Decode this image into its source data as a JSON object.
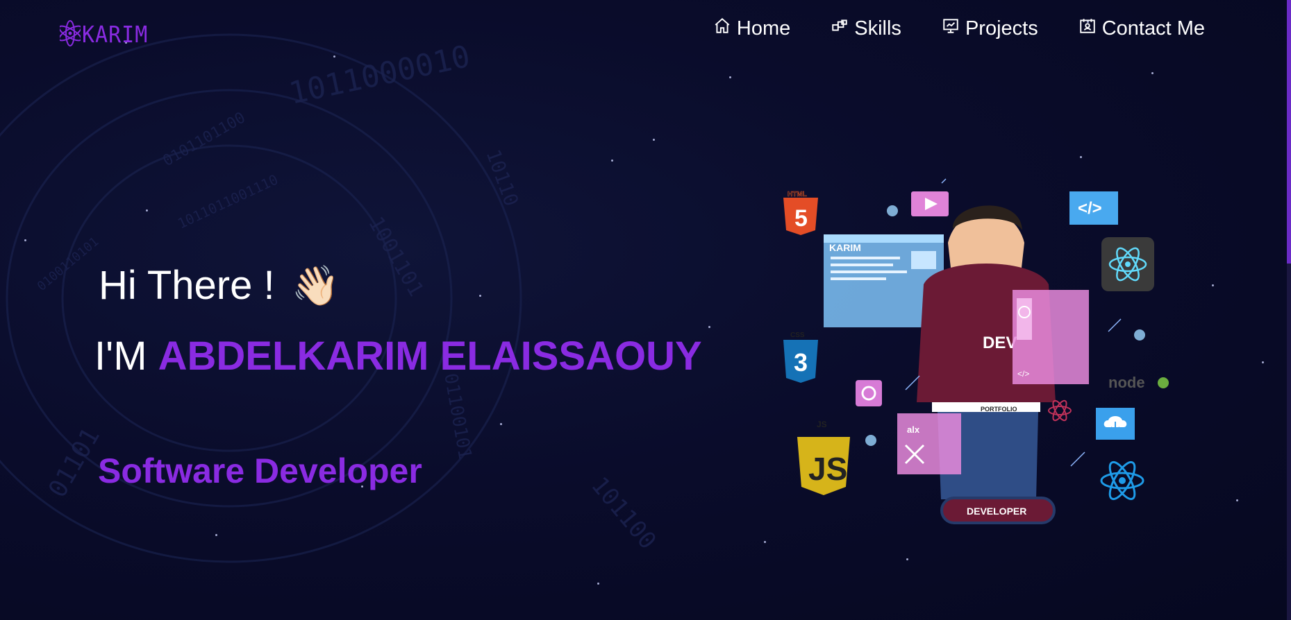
{
  "logo": {
    "text": "KARIM",
    "icon": "atom-icon"
  },
  "nav": [
    {
      "label": "Home",
      "icon": "home-icon"
    },
    {
      "label": "Skills",
      "icon": "skills-icon"
    },
    {
      "label": "Projects",
      "icon": "projects-icon"
    },
    {
      "label": "Contact Me",
      "icon": "contact-icon"
    }
  ],
  "hero": {
    "greeting": "Hi There !",
    "wave_emoji": "👋🏻",
    "intro_prefix": "I'M",
    "name": "ABDELKARIM ELAISSAOUY",
    "role": "Software Developer"
  },
  "illustration": {
    "window_title": "KARIM",
    "shirt_text": "DEV",
    "belt_text": "PORTFOLIO",
    "badge_text": "DEVELOPER",
    "html_label": "HTML",
    "css_label": "CSS",
    "js_label": "JS",
    "node_label": "node",
    "code_tag": "</>",
    "alx_label": "alx"
  },
  "colors": {
    "accent": "#8a2be2",
    "background": "#0a0c2b",
    "text": "#ffffff"
  }
}
